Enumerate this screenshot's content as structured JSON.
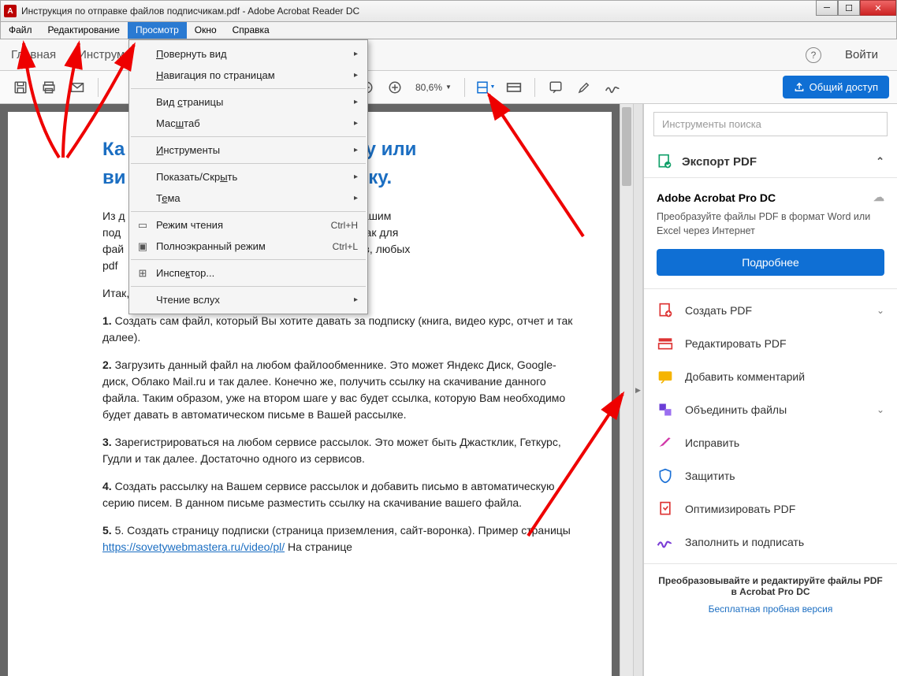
{
  "window": {
    "title": "Инструкция по отправке файлов подписчикам.pdf - Adobe Acrobat Reader DC"
  },
  "menubar": {
    "file": "Файл",
    "edit": "Редактирование",
    "view": "Просмотр",
    "window": "Окно",
    "help": "Справка"
  },
  "tabs": {
    "main": "Главная",
    "tools": "Инструменты",
    "login": "Войти"
  },
  "toolbar": {
    "zoom": "80,6%",
    "share": "Общий доступ"
  },
  "dropdown": {
    "rotate": "Повернуть вид",
    "nav": "Навигация по страницам",
    "pageview": "Вид страницы",
    "scale": "Масштаб",
    "instruments": "Инструменты",
    "showhide": "Показать/Скрыть",
    "theme": "Тема",
    "readmode": "Режим чтения",
    "readmode_sc": "Ctrl+H",
    "fullscreen": "Полноэкранный режим",
    "fullscreen_sc": "Ctrl+L",
    "inspector": "Инспектор...",
    "readaloud": "Чтение вслух"
  },
  "document": {
    "h1a": "Ка",
    "h1b": "ю книгу или",
    "h1c": "ви",
    "h1d": "счику.",
    "p1a": "Из д",
    "p1b": "лять любые файлы Вашим",
    "p1c": "под",
    "p1d": "есть, схема подходит как для",
    "p1e": "фай",
    "p1f": "урсов, для аудио курсов, любых",
    "p1g": "pdf",
    "p2": "Итак, давайте все разберем по шагам.",
    "p3": "1. Создать сам файл, который Вы хотите давать за подписку (книга, видео курс, отчет и так далее).",
    "p4": "2. Загрузить данный файл на любом файлообменнике. Это может Яндекс Диск, Google-диск, Облако Mail.ru и так далее. Конечно же, получить ссылку на скачивание данного файла. Таким образом, уже на втором шаге у вас будет ссылка, которую Вам необходимо будет давать в автоматическом письме в Вашей рассылке.",
    "p5": "3. Зарегистрироваться на любом сервисе рассылок. Это может быть Джастклик, Геткурс, Гудли и так далее. Достаточно одного из сервисов.",
    "p6": "4. Создать рассылку на Вашем сервисе рассылок и добавить письмо в автоматическую серию писем. В данном письме разместить ссылку на скачивание вашего файла.",
    "p7a": "5. Создать страницу подписки (страница приземления, сайт-воронка). Пример страницы ",
    "p7link": "https://sovetywebmastera.ru/video/pl/",
    "p7b": " На странице"
  },
  "rightpanel": {
    "search_ph": "Инструменты поиска",
    "export": "Экспорт PDF",
    "promo_name": "Adobe Acrobat Pro DC",
    "promo_desc": "Преобразуйте файлы PDF в формат Word или Excel через Интернет",
    "promo_btn": "Подробнее",
    "tools": {
      "create": "Создать PDF",
      "edit": "Редактировать PDF",
      "comment": "Добавить комментарий",
      "combine": "Объединить файлы",
      "fix": "Исправить",
      "protect": "Защитить",
      "optimize": "Оптимизировать PDF",
      "fillsign": "Заполнить и подписать"
    },
    "footer1": "Преобразовывайте и редактируйте файлы PDF в Acrobat Pro DC",
    "footer2": "Бесплатная пробная версия"
  }
}
